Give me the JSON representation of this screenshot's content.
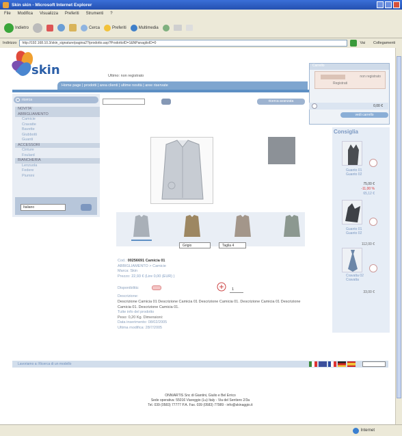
{
  "window": {
    "title": "Skin skin - Microsoft Internet Explorer"
  },
  "menu": [
    "File",
    "Modifica",
    "Visualizza",
    "Preferiti",
    "Strumenti",
    "?"
  ],
  "toolbar": {
    "back": "Indietro",
    "search": "Cerca",
    "favorites": "Preferiti",
    "multimedia": "Multimedia"
  },
  "address": {
    "label": "Indirizzo",
    "url": "http://192.168.10.3/skin_signature/pagina2?/prodotto.asp?ProdottoID=1&NPanaglioID=0",
    "go": "Vai",
    "links": "Collegamenti"
  },
  "site": {
    "logo_text": "skin",
    "top_tab": "Ultimo: non registrato",
    "navbar": "Home page | prodotti | area clienti | ultime novità | aree riservate",
    "cart": {
      "header": "Carrello",
      "login": "non registrato",
      "register": "Registrati",
      "total": "0,00 €",
      "checkout_button": "vedi carrello"
    },
    "search_placeholder": "ricerca",
    "advanced_search": "ricerca avanzata",
    "categories": [
      {
        "label": "NOVITA'",
        "head": true
      },
      {
        "label": "ABBIGLIAMENTO",
        "head": true
      },
      {
        "label": "Camicie",
        "head": false
      },
      {
        "label": "Cravatte",
        "head": false
      },
      {
        "label": "Bavette",
        "head": false
      },
      {
        "label": "Giubbotti",
        "head": false
      },
      {
        "label": "Guanti",
        "head": false
      },
      {
        "label": "ACCESSORI",
        "head": true
      },
      {
        "label": "Cinture",
        "head": false
      },
      {
        "label": "Foulard",
        "head": false
      },
      {
        "label": "BIANCHERIA",
        "head": true
      },
      {
        "label": "Lenzuola",
        "head": false
      },
      {
        "label": "Federe",
        "head": false
      },
      {
        "label": "Piumini",
        "head": false
      }
    ],
    "language": {
      "value": "Italiano"
    },
    "product": {
      "color_select": "Grigio",
      "size_select": "Taglia 4",
      "code_label": "Cod.:",
      "code": "00256691",
      "name": "Camicia 01",
      "line1": "ABBIGLIAMENTO > Camicie",
      "line2": "Marca: Skin",
      "price_label": "Prezzo:",
      "price": "22,93 € (Lire 0,00 (EUR) )",
      "availability_label": "Disponibilità:",
      "qty": "1",
      "description_label": "Descrizione:",
      "description": "Descrizione Camicia 01 Descrizione Camicia 01 Descrizione Camicia 01. Descrizione Camicia 01 Descrizione Camicia 01. Descrizione Camicia 01.",
      "extra1": "Tutte info del prodotto",
      "weight": "Peso: 0,20 Kg.      Dimensioni:",
      "insert_date": "Data inserimento: 08/02/2005",
      "modify_date": "Ultima modifica: 28/7/2005"
    },
    "rail": {
      "header": "Consiglia",
      "items": [
        {
          "name": "Guanto 01 Guanto 02",
          "price_old": "75,00 €",
          "price_new": "-11,00 %",
          "price": "65,12 €"
        },
        {
          "name": "Guanto 01 Guanto 02",
          "price": "112,00 €"
        },
        {
          "name": "Cravatta 02 Cravatta",
          "price": "33,00 €"
        }
      ]
    },
    "footer_bar": "Lavoriamo a: Ricerca di un modello",
    "footer": {
      "company": "ONNIARTIS Snc",
      "line1": "ONNIARTIS Snc di Giantini, Giulio e Bel Errico",
      "line2": "Sede operativa: 55016 Viareggio (Lu) Italy - Via del Sentiero 2/3a",
      "line3": "Tel. 039 (0583) 77777 P.A. Fax. 039 (0583) 77989 - info@skinaggio.it"
    }
  },
  "status": {
    "left": "",
    "zone": "Internet"
  }
}
